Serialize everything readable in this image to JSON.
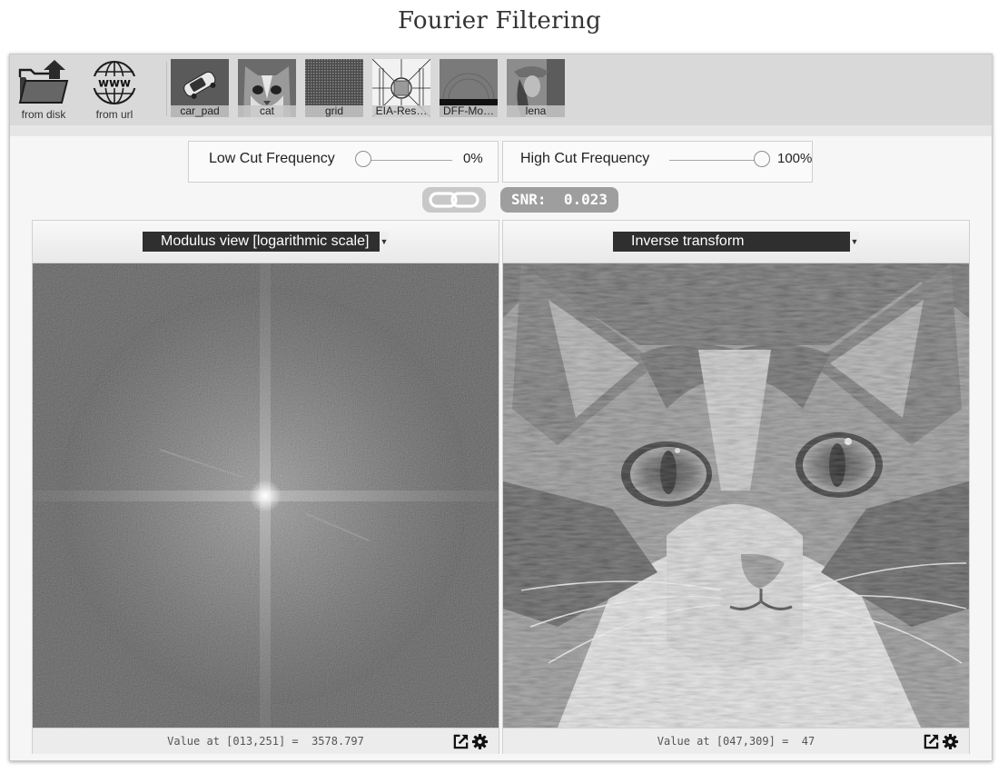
{
  "page": {
    "title": "Fourier Filtering"
  },
  "toolbar": {
    "from_disk_label": "from disk",
    "from_url_label": "from url",
    "www_text": "www",
    "images": [
      {
        "label": "car_pad"
      },
      {
        "label": "cat"
      },
      {
        "label": "grid"
      },
      {
        "label": "EIA-Res…"
      },
      {
        "label": "DFF-Mo…"
      },
      {
        "label": "lena"
      }
    ]
  },
  "filters": {
    "low": {
      "label": "Low Cut Frequency",
      "value_text": "0%",
      "value": 0
    },
    "high": {
      "label": "High Cut Frequency",
      "value_text": "100%",
      "value": 100
    }
  },
  "snr": {
    "label": "SNR:",
    "value": "0.023"
  },
  "left_panel": {
    "view": "Modulus view [logarithmic scale]",
    "readout": "Value at [013,251] =  3578.797"
  },
  "right_panel": {
    "view": "Inverse transform",
    "readout": "Value at [047,309] =  47"
  },
  "colors": {
    "toolbar_bg": "#d9d9d9",
    "select_bg": "#2f2f2f",
    "snr_bg": "#9e9e9e",
    "link_bg": "#c8c8c8"
  },
  "icons": {
    "from_disk": "folder-upload-icon",
    "from_url": "globe-www-icon",
    "link": "chain-link-icon",
    "popout": "external-link-icon",
    "settings": "gear-icon",
    "dropdown": "chevron-down-icon"
  }
}
